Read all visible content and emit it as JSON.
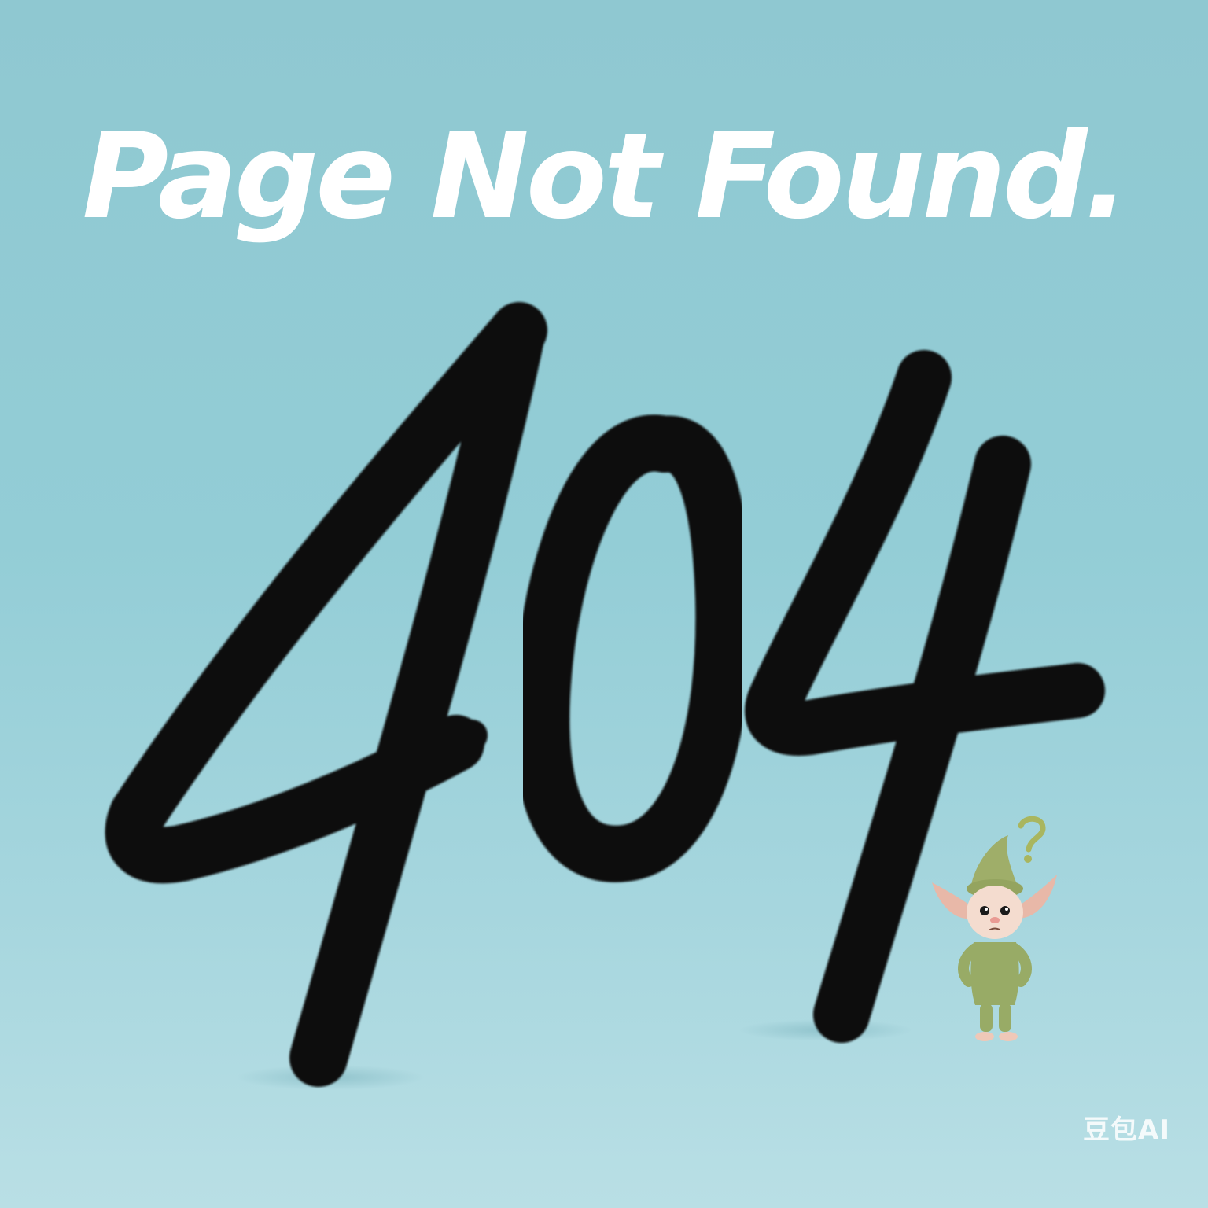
{
  "page": {
    "headline": "Page Not Found.",
    "error_code": "404",
    "watermark": "豆包AI",
    "background_color": "#93cdd6",
    "ink_color": "#0a0a0a",
    "headline_color": "#ffffff"
  },
  "mascot": {
    "icon": "confused-elf-icon",
    "accessory_icon": "question-mark-icon"
  }
}
